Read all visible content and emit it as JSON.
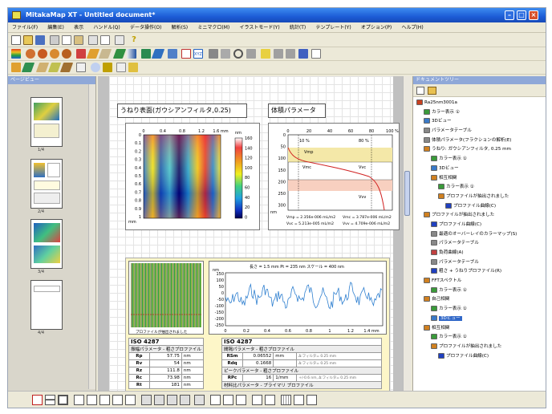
{
  "window": {
    "title": "MitakaMap XT - Untitled document*"
  },
  "menu": [
    "ファイル(F)",
    "編集(E)",
    "表示",
    "ハンドル(Q)",
    "データ操作(O)",
    "解析(S)",
    "ミニマクロ(M)",
    "イラストモード(Y)",
    "統計(T)",
    "テンプレート(Y)",
    "オプション(P)",
    "ヘルプ(H)"
  ],
  "left_panel": {
    "title": "ページビュー",
    "pages": [
      "1/4",
      "2/4",
      "3/4",
      "4/4"
    ]
  },
  "right_panel": {
    "title": "ドキュメントツリー"
  },
  "tree": [
    {
      "label": "Ra25nm3001a",
      "level": 0,
      "color": "#c84020"
    },
    {
      "label": "カラー表示 ①",
      "level": 1,
      "color": "#3a9a3a"
    },
    {
      "label": "3Dビュー",
      "level": 1,
      "color": "#3a7ac8"
    },
    {
      "label": "パラメータテーブル",
      "level": 1,
      "color": "#888888"
    },
    {
      "label": "体積パラメータ(フラクションの解析(E)",
      "level": 1,
      "color": "#888888"
    },
    {
      "label": "うねり: ガウシアンフィルタ, 0.25 mm",
      "level": 1,
      "color": "#d08020"
    },
    {
      "label": "カラー表示 ①",
      "level": 2,
      "color": "#3a9a3a"
    },
    {
      "label": "3Dビュー",
      "level": 2,
      "color": "#3a7ac8"
    },
    {
      "label": "相互相関",
      "level": 2,
      "color": "#d08020"
    },
    {
      "label": "カラー表示 ①",
      "level": 3,
      "color": "#3a9a3a"
    },
    {
      "label": "プロファイルが抽出されました",
      "level": 3,
      "color": "#d08020"
    },
    {
      "label": "プロファイル曲線(C)",
      "level": 4,
      "color": "#2040c0"
    },
    {
      "label": "プロファイルが抽出されました",
      "level": 1,
      "color": "#d08020"
    },
    {
      "label": "プロファイル曲線(C)",
      "level": 2,
      "color": "#2040c0"
    },
    {
      "label": "最適のオーバーレイのカラーマップ(S)",
      "level": 2,
      "color": "#888888"
    },
    {
      "label": "パラメータテーブル",
      "level": 2,
      "color": "#888888"
    },
    {
      "label": "負荷曲線(A)",
      "level": 2,
      "color": "#c04040"
    },
    {
      "label": "パラメータテーブル",
      "level": 2,
      "color": "#888888"
    },
    {
      "label": "粗さ + うねりプロファイル(R)",
      "level": 2,
      "color": "#2040c0"
    },
    {
      "label": "FFTスペクトル",
      "level": 1,
      "color": "#d08020"
    },
    {
      "label": "カラー表示 ①",
      "level": 2,
      "color": "#3a9a3a"
    },
    {
      "label": "自己相関",
      "level": 1,
      "color": "#d08020"
    },
    {
      "label": "カラー表示 ①",
      "level": 2,
      "color": "#3a9a3a"
    },
    {
      "label": "3Dビュー",
      "level": 2,
      "color": "#3a7ac8",
      "selected": true
    },
    {
      "label": "相互相関",
      "level": 1,
      "color": "#d08020"
    },
    {
      "label": "カラー表示 ①",
      "level": 2,
      "color": "#3a9a3a"
    },
    {
      "label": "プロファイルが抽出されました",
      "level": 2,
      "color": "#d08020"
    },
    {
      "label": "プロファイル曲線(C)",
      "level": 3,
      "color": "#2040c0"
    }
  ],
  "doc": {
    "waviness_title": "うねり表面(ガウシアンフィルタ,0.25)",
    "volume_title": "体積パラメータ",
    "heatmap": {
      "top_ticks": [
        "0",
        "0.4",
        "0.8",
        "1.2",
        "1.6 mm"
      ],
      "left_ticks": [
        "0",
        "0.1",
        "0.2",
        "0.3",
        "0.4",
        "0.5",
        "0.6",
        "0.7",
        "0.8",
        "0.9",
        "1"
      ],
      "left_unit": "mm",
      "scale_unit": "nm",
      "scale_ticks": [
        "160",
        "140",
        "120",
        "100",
        "80",
        "60",
        "40",
        "20",
        "0"
      ]
    },
    "volume_chart": {
      "top_ticks": [
        "0",
        "20",
        "40",
        "60",
        "80",
        "100 %"
      ],
      "left_ticks": [
        "0",
        "50",
        "100",
        "150",
        "200",
        "250",
        "300"
      ],
      "left_unit": "nm",
      "labels": [
        "10 %",
        "80 %",
        "Vmp",
        "Vmc",
        "Vvc",
        "Vvv"
      ],
      "footer": [
        "Vmp = 2.356e-006 mL/m2",
        "Vmc = 3.787e-006 mL/m2",
        "Vvc = 5.213e-005 mL/m2",
        "Vvv = 4.709e-006 mL/m2"
      ]
    },
    "profile_chart": {
      "header": "長さ = 1.5 mm  Pt = 235 nm  スケール = 400 nm",
      "y_unit": "nm",
      "y_ticks": [
        "150",
        "100",
        "50",
        "0",
        "-50",
        "-100",
        "-150",
        "-200",
        "-250"
      ],
      "x_ticks": [
        "0",
        "0.2",
        "0.4",
        "0.6",
        "0.8",
        "1",
        "1.2",
        "1.4 mm"
      ],
      "thumb_caption": "プロファイルが抽出されました"
    },
    "table1": {
      "title": "ISO 4287",
      "subtitle": "振幅パラメータ - 粗さプロファイル",
      "rows": [
        [
          "Rp",
          "57.75",
          "nm"
        ],
        [
          "Rv",
          "54",
          "nm"
        ],
        [
          "Rz",
          "111.8",
          "nm"
        ],
        [
          "Rc",
          "73.98",
          "nm"
        ],
        [
          "Rt",
          "181",
          "nm"
        ]
      ]
    },
    "table2": {
      "title": "ISO 4287",
      "subtitle": "間隔パラメータ - 粗さプロファイル",
      "rows": [
        [
          "RSm",
          "0.06552",
          "mm",
          "Δ:フィルタ= 0.25 mm"
        ],
        [
          "Rdq",
          "0.1668",
          "",
          "Δ:フィルタ= 0.25 mm"
        ]
      ],
      "subtitle2": "ピークパラメータ - 粗さプロファイル",
      "rows2": [
        [
          "RPc",
          "16",
          "1/mm",
          "+/-0.6 nm, Δ:フィルタ= 0.25 mm"
        ]
      ],
      "subtitle3": "材料比パラメータ - プライマリ プロファイル"
    }
  }
}
